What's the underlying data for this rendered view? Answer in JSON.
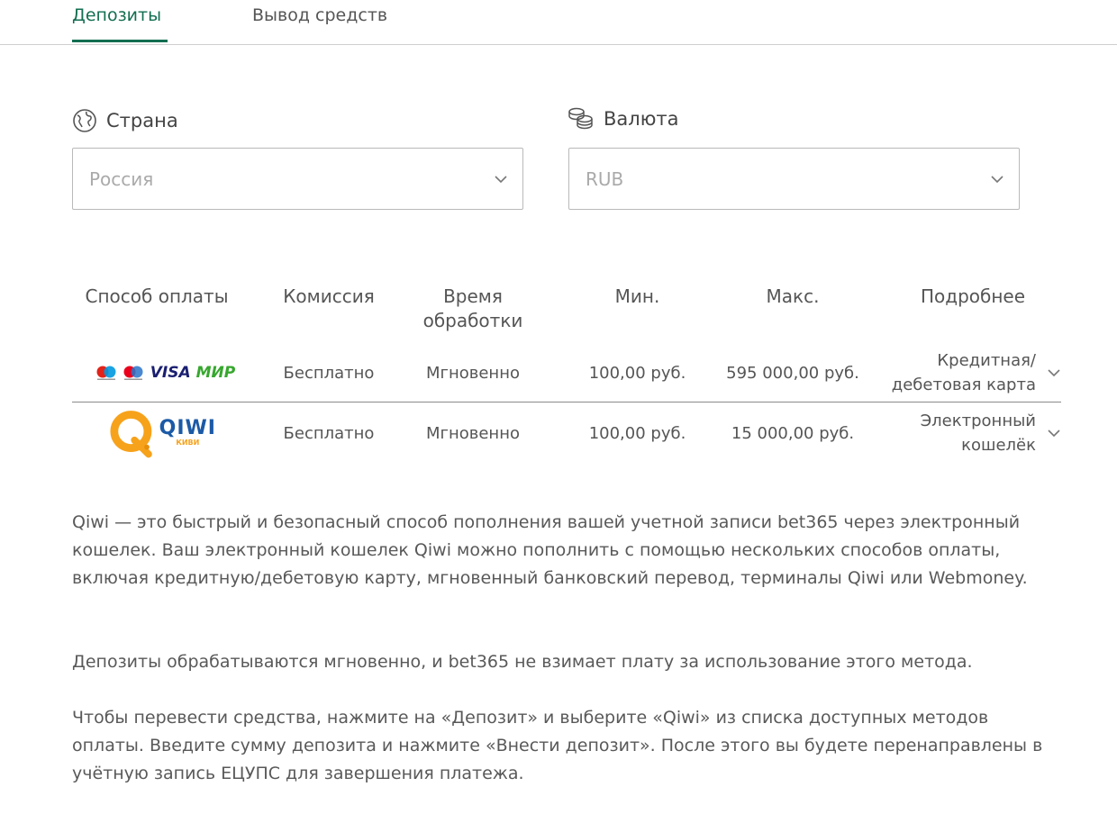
{
  "tabs": [
    {
      "label": "Депозиты",
      "active": true
    },
    {
      "label": "Вывод средств",
      "active": false
    }
  ],
  "colors": {
    "accent": "#126e51",
    "text": "#545454",
    "placeholder": "#aaaaaa",
    "qiwi_orange": "#f7a21b",
    "qiwi_blue": "#1c5aa6"
  },
  "country": {
    "label": "Страна",
    "icon": "globe-icon",
    "value": "Россия"
  },
  "currency": {
    "label": "Валюта",
    "icon": "coins-icon",
    "value": "RUB"
  },
  "table": {
    "headers": [
      "Способ оплаты",
      "Комиссия",
      "Время обработки",
      "Мин.",
      "Макс.",
      "Подробнее"
    ],
    "header_lines": {
      "time_1": "Время",
      "time_2": "обработки"
    },
    "rows": [
      {
        "logo": "cards-logo",
        "logo_text": {
          "visa": "VISA",
          "mir": "МИР"
        },
        "fee": "Бесплатно",
        "time": "Мгновенно",
        "min": "100,00 руб.",
        "max": "595 000,00 руб.",
        "details_1": "Кредитная/",
        "details_2": "дебетовая карта"
      },
      {
        "logo": "qiwi-logo",
        "logo_text": {
          "name": "QIWI",
          "sub": "КИВИ"
        },
        "fee": "Бесплатно",
        "time": "Мгновенно",
        "min": "100,00 руб.",
        "max": "15 000,00 руб.",
        "details_1": "Электронный",
        "details_2": "кошелёк"
      }
    ]
  },
  "description": {
    "p1": "Qiwi — это быстрый и безопасный способ пополнения вашей учетной записи bet365 через электронный кошелек. Ваш электронный кошелек Qiwi можно пополнить с помощью нескольких способов оплаты, включая кредитную/дебетовую карту, мгновенный банковский перевод, терминалы Qiwi или Webmoney.",
    "p2": "Депозиты обрабатываются мгновенно, и bet365 не взимает плату за использование этого метода.",
    "p3": "Чтобы перевести средства, нажмите на «Депозит» и выберите «Qiwi» из списка доступных методов оплаты. Введите сумму депозита и нажмите «Внести депозит». После этого вы будете перенаправлены в учётную запись ЕЦУПС для завершения платежа."
  }
}
